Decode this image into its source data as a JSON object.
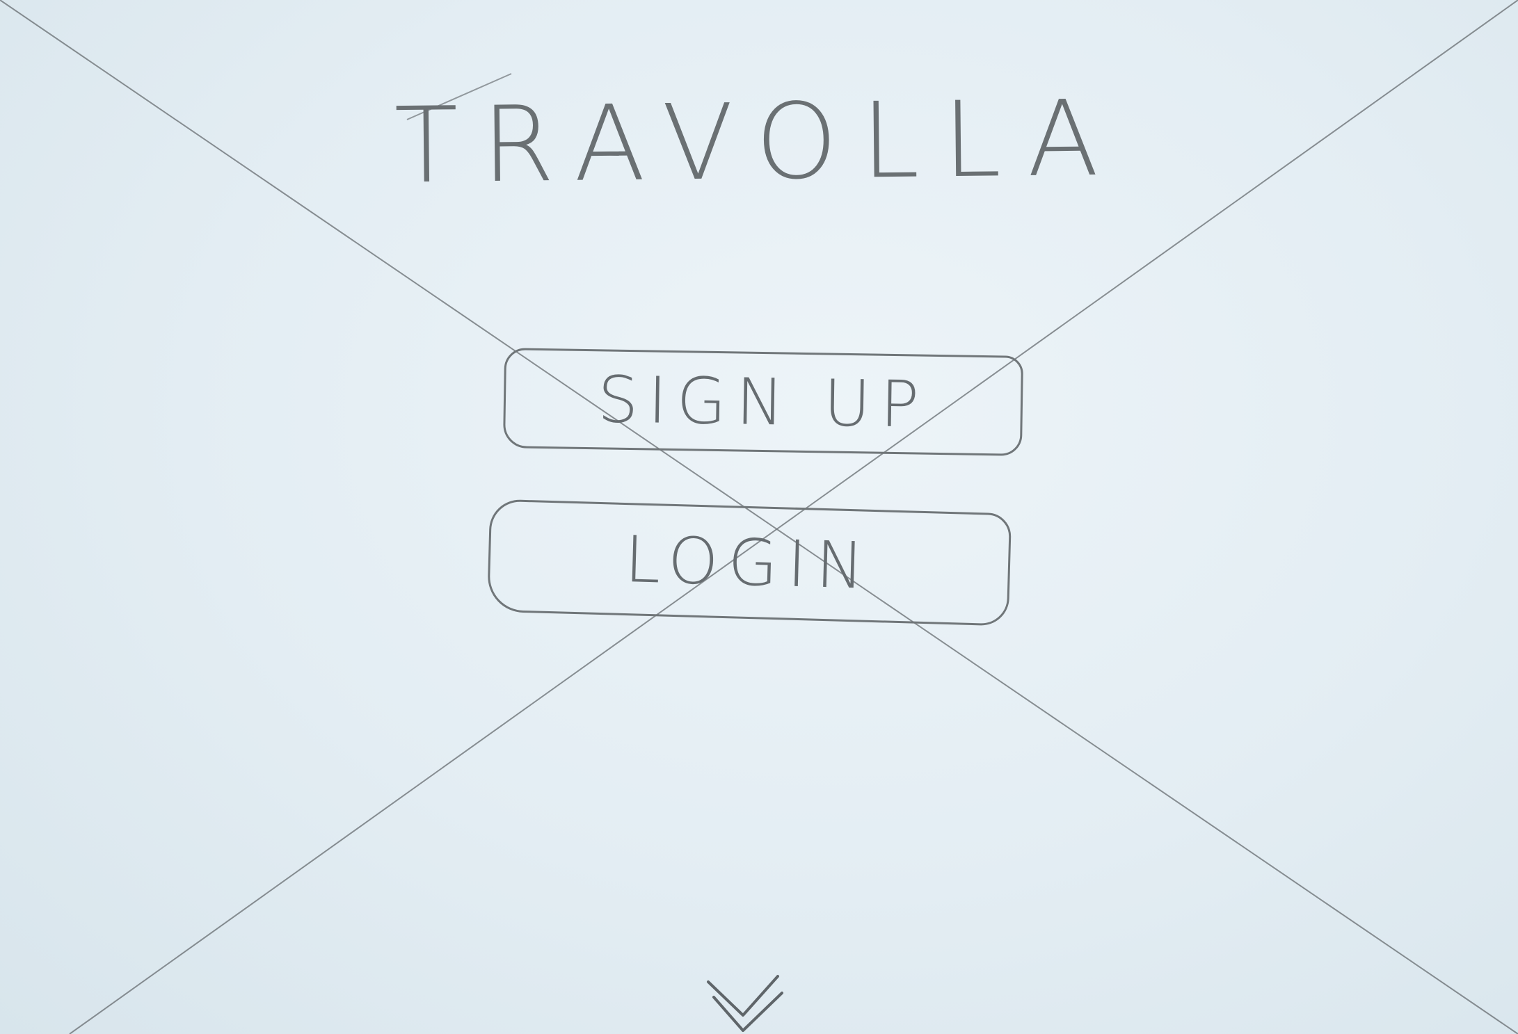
{
  "app": {
    "title": "TRAVOLLA"
  },
  "actions": {
    "signup_label": "SIGN UP",
    "login_label": "LOGIN"
  },
  "icons": {
    "scroll": "chevron-down-icon"
  },
  "colors": {
    "paper": "#e4eef4",
    "pencil": "#6a7073"
  }
}
